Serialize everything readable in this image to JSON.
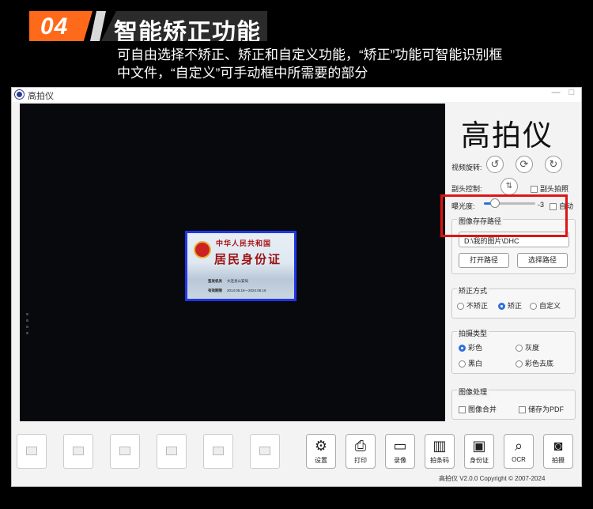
{
  "banner": {
    "step_number": "04",
    "title": "智能矫正功能",
    "description_line1": "可自由选择不矫正、矫正和自定义功能，“矫正”功能可智能识别框",
    "description_line2": "中文件，“自定义”可手动框中所需要的部分"
  },
  "window": {
    "title": "高拍仪",
    "min_label": "—",
    "close_label": "□"
  },
  "preview": {
    "idcard": {
      "line1": "中华人民共和国",
      "line2": "居民身份证",
      "authority_label": "签发机关",
      "authority_value": "大连县公安局",
      "validity_label": "有效期限",
      "validity_value": "2014.06.16—2024.06.16"
    }
  },
  "panel": {
    "app_title": "高拍仪",
    "video_rotate_label": "视频旋转:",
    "camera_control_label": "副头控制:",
    "sub_camera_shoot_label": "副头拍照",
    "exposure_label": "曝光度:",
    "exposure_value": "-3",
    "exposure_fraction": 0.22,
    "auto_label": "自动",
    "save_path": {
      "group_title": "图像存存路径",
      "path_value": "D:\\我的图片\\DHC",
      "open_label": "打开路径",
      "choose_label": "选择路径"
    },
    "correction": {
      "group_title": "矫正方式",
      "options": [
        "不矫正",
        "矫正",
        "自定义"
      ],
      "selected": "矫正"
    },
    "shoot_type": {
      "group_title": "拍摄类型",
      "options": [
        "彩色",
        "灰度",
        "黑白",
        "彩色去底"
      ],
      "selected": "彩色"
    },
    "image_process": {
      "group_title": "图像处理",
      "merge_label": "图像合并",
      "save_pdf_label": "储存为PDF"
    }
  },
  "toolbar": {
    "settings": "设置",
    "print": "打印",
    "record": "录像",
    "barcode": "拍条码",
    "idcard": "身份证",
    "ocr": "OCR",
    "capture": "拍摄"
  },
  "footer": "高拍仪 V2.0.0 Copyright © 2007-2024",
  "colors": {
    "badge_orange": "#ff6a1a",
    "highlight_red": "#e01414",
    "accent_blue": "#2e6fe0"
  }
}
